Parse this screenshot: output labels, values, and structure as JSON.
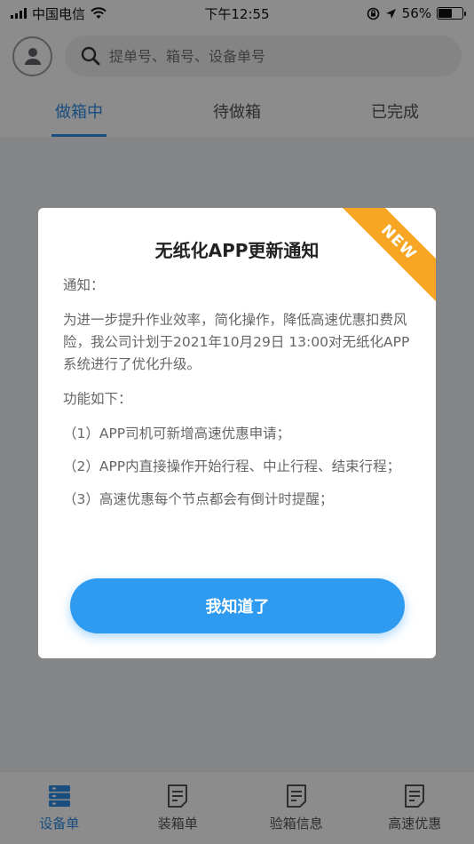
{
  "status_bar": {
    "carrier": "中国电信",
    "time": "下午12:55",
    "battery": "56%",
    "battery_level": 0.56
  },
  "search": {
    "placeholder": "提单号、箱号、设备单号"
  },
  "tabs": [
    {
      "label": "做箱中",
      "active": true
    },
    {
      "label": "待做箱",
      "active": false
    },
    {
      "label": "已完成",
      "active": false
    }
  ],
  "bottom_nav": [
    {
      "label": "设备单",
      "active": true,
      "icon": "server-icon"
    },
    {
      "label": "装箱单",
      "active": false,
      "icon": "document-icon"
    },
    {
      "label": "验箱信息",
      "active": false,
      "icon": "document-icon"
    },
    {
      "label": "高速优惠",
      "active": false,
      "icon": "document-icon"
    }
  ],
  "dialog": {
    "ribbon": "NEW",
    "title": "无纸化APP更新通知",
    "notice_label": "通知：",
    "notice_text": "为进一步提升作业效率，简化操作，降低高速优惠扣费风险，我公司计划于2021年10月29日 13:00对无纸化APP系统进行了优化升级。",
    "features_label": "功能如下：",
    "features": [
      "（1）APP司机可新增高速优惠申请；",
      "（2）APP内直接操作开始行程、中止行程、结束行程；",
      "（3）高速优惠每个节点都会有倒计时提醒；"
    ],
    "confirm_label": "我知道了"
  },
  "colors": {
    "accent": "#2f8ee8",
    "button": "#2f9bf0",
    "ribbon": "#f6a623"
  }
}
